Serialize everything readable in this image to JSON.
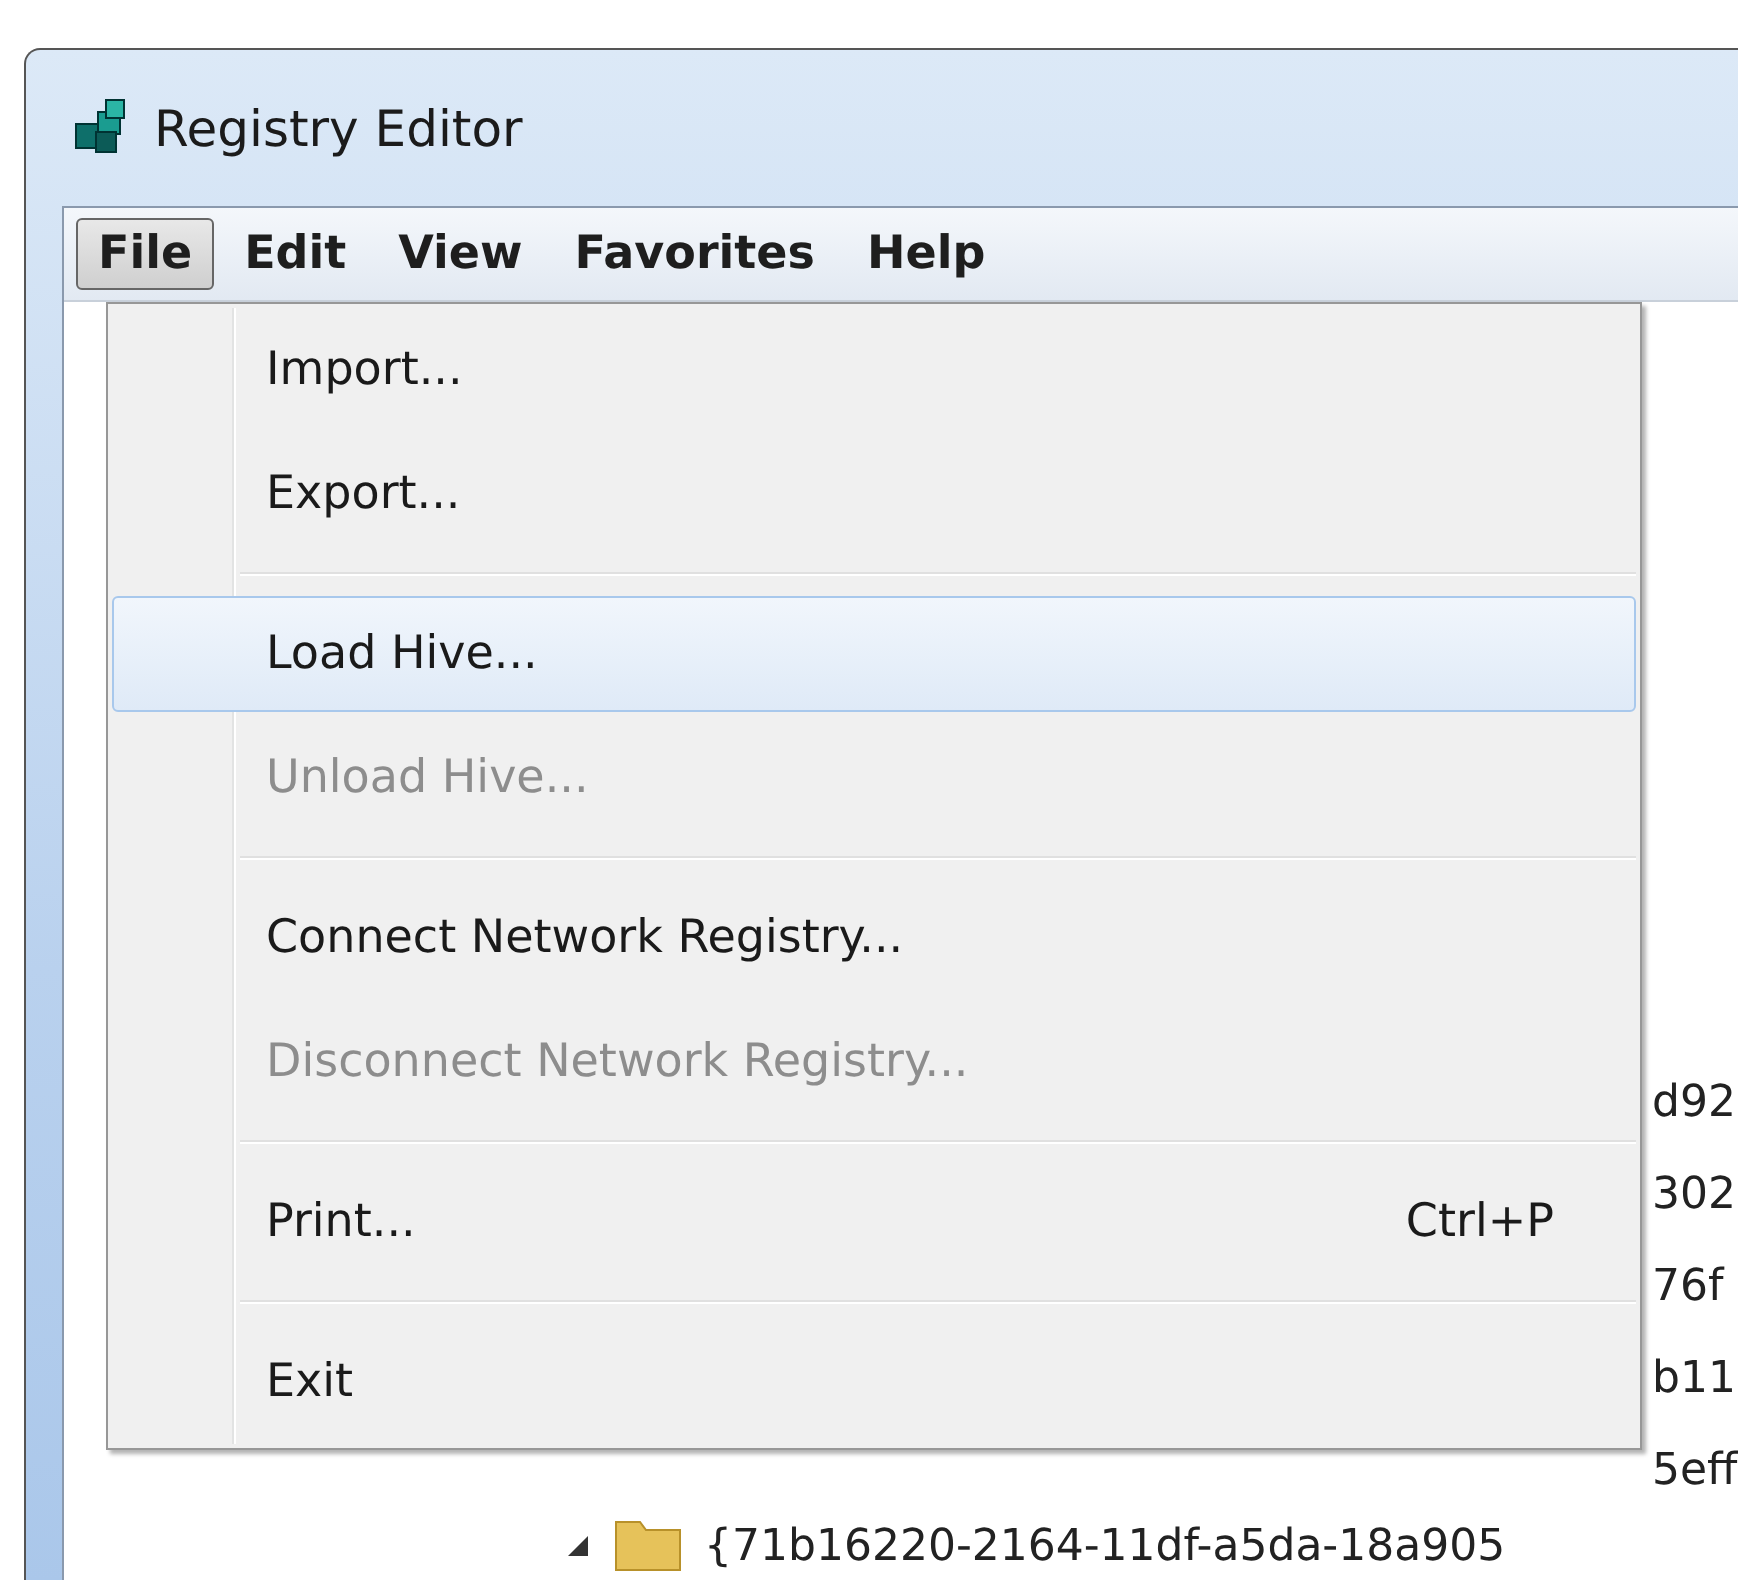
{
  "window": {
    "title": "Registry Editor"
  },
  "menu_bar": [
    {
      "label": "File",
      "selected": true
    },
    {
      "label": "Edit",
      "selected": false
    },
    {
      "label": "View",
      "selected": false
    },
    {
      "label": "Favorites",
      "selected": false
    },
    {
      "label": "Help",
      "selected": false
    }
  ],
  "file_menu": [
    {
      "kind": "item",
      "label": "Import...",
      "selected": false,
      "disabled": false
    },
    {
      "kind": "item",
      "label": "Export...",
      "selected": false,
      "disabled": false
    },
    {
      "kind": "separator"
    },
    {
      "kind": "item",
      "label": "Load Hive...",
      "selected": true,
      "disabled": false
    },
    {
      "kind": "item",
      "label": "Unload Hive...",
      "selected": false,
      "disabled": true
    },
    {
      "kind": "separator"
    },
    {
      "kind": "item",
      "label": "Connect Network Registry...",
      "selected": false,
      "disabled": false
    },
    {
      "kind": "item",
      "label": "Disconnect Network Registry...",
      "selected": false,
      "disabled": true
    },
    {
      "kind": "separator"
    },
    {
      "kind": "item",
      "label": "Print...",
      "shortcut": "Ctrl+P",
      "selected": false,
      "disabled": false
    },
    {
      "kind": "separator"
    },
    {
      "kind": "item",
      "label": "Exit",
      "selected": false,
      "disabled": false
    }
  ],
  "tree_fragments": [
    "d92",
    "302",
    "76f",
    "b11",
    "5eff"
  ],
  "tree_row": {
    "label": "{71b16220-2164-11df-a5da-18a905"
  }
}
